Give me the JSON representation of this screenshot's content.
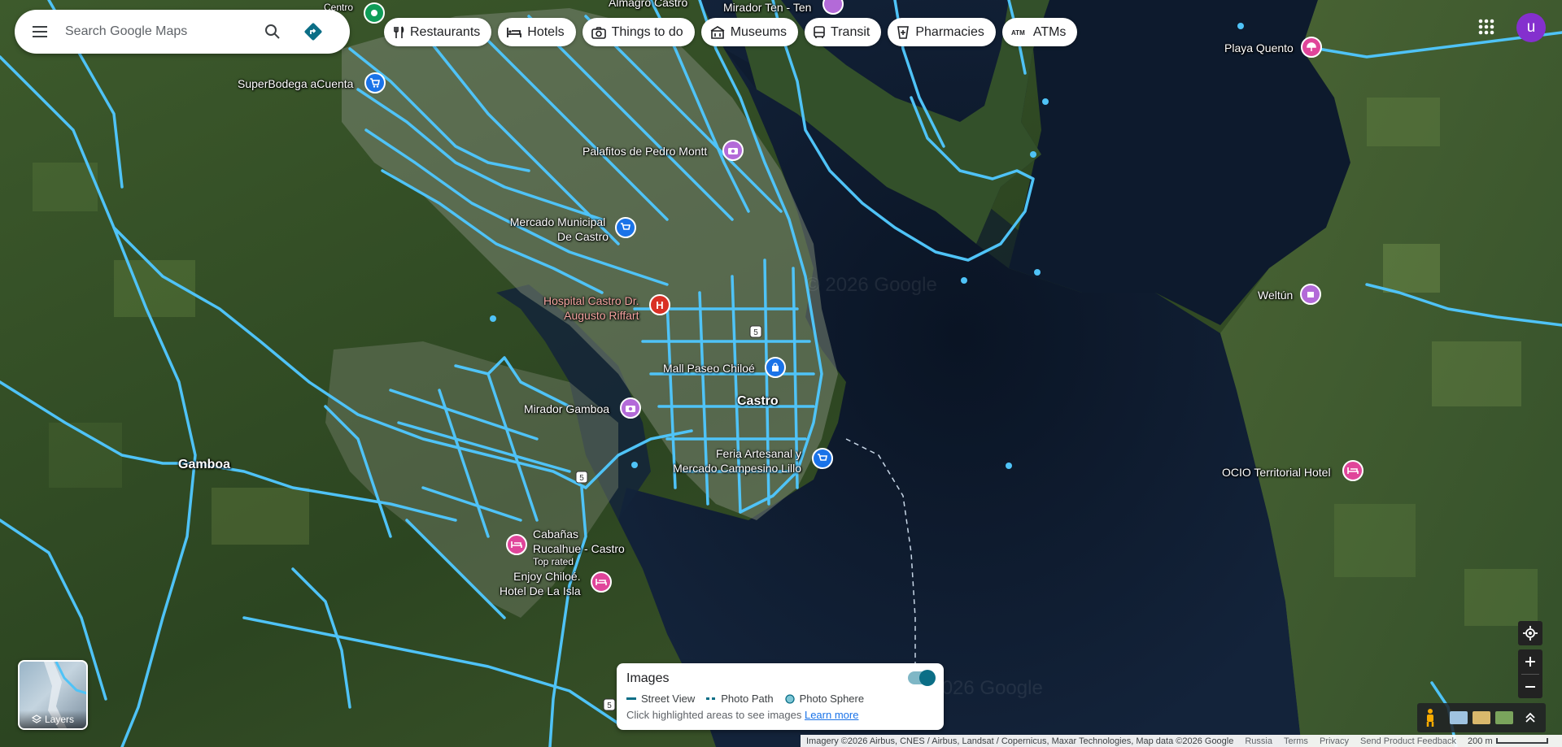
{
  "search": {
    "placeholder": "Search Google Maps"
  },
  "chips": [
    {
      "label": "Restaurants",
      "icon": "fork-knife-icon"
    },
    {
      "label": "Hotels",
      "icon": "bed-icon"
    },
    {
      "label": "Things to do",
      "icon": "camera-icon"
    },
    {
      "label": "Museums",
      "icon": "museum-icon"
    },
    {
      "label": "Transit",
      "icon": "bus-icon"
    },
    {
      "label": "Pharmacies",
      "icon": "pharmacy-icon"
    },
    {
      "label": "ATMs",
      "icon": "atm-icon"
    }
  ],
  "account": {
    "initial": "u"
  },
  "layers": {
    "label": "Layers"
  },
  "images_panel": {
    "title": "Images",
    "legend": [
      "Street View",
      "Photo Path",
      "Photo Sphere"
    ],
    "hint": "Click highlighted areas to see images",
    "learn_more": "Learn more",
    "enabled": true
  },
  "footer": {
    "attribution": "Imagery ©2026 Airbus, CNES / Airbus, Landsat / Copernicus, Maxar Technologies, Map data ©2026 Google",
    "links": [
      "Russia",
      "Terms",
      "Privacy",
      "Send Product Feedback"
    ],
    "scale": "200 m"
  },
  "watermark": "© 2026 Google",
  "places": {
    "almagro": "Almagro Castro",
    "mirador_ten": "Mirador Ten - Ten",
    "centro": "Centro",
    "playa_quento": "Playa Quento",
    "superbodega": "SuperBodega aCuenta",
    "palafitos": "Palafitos de Pedro Montt",
    "mercado_municipal_1": "Mercado Municipal",
    "mercado_municipal_2": "De Castro",
    "hospital_1": "Hospital Castro Dr.",
    "hospital_2": "Augusto Riffart",
    "weltun": "Weltún",
    "mall": "Mall Paseo Chiloé",
    "castro": "Castro",
    "mirador_gamboa": "Mirador Gamboa",
    "feria_1": "Feria Artesanal y",
    "feria_2": "Mercado Campesino Lillo",
    "gamboa": "Gamboa",
    "ocio": "OCIO Territorial Hotel",
    "cabanas_1": "Cabañas",
    "cabanas_2": "Rucalhue - Castro",
    "cabanas_3": "Top rated",
    "enjoy_1": "Enjoy Chiloé.",
    "enjoy_2": "Hotel De La Isla",
    "route_5": "5"
  },
  "colors": {
    "street_view": "#4fc3f7",
    "sea": "#0e1a2c",
    "land": "#2e4522",
    "pin_attraction": "#b36ad8",
    "pin_shopping": "#1a73e8",
    "pin_hotel": "#e0459a",
    "pin_hospital": "#d93025"
  }
}
